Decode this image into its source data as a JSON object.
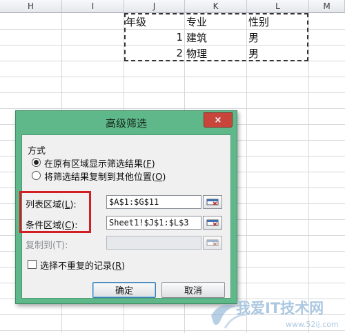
{
  "sheet": {
    "columns": [
      "H",
      "I",
      "J",
      "K",
      "L",
      "M"
    ],
    "criteria_rows": [
      {
        "no": "",
        "major": "专业",
        "gender": "性别",
        "head": "年级"
      },
      {
        "no": "1",
        "major": "建筑",
        "gender": "男",
        "head": ""
      },
      {
        "no": "2",
        "major": "物理",
        "gender": "男",
        "head": ""
      }
    ]
  },
  "dialog": {
    "title": "高级筛选",
    "close_glyph": "×",
    "method_label": "方式",
    "option_inplace": "在原有区域显示筛选结果(",
    "option_inplace_key": "F",
    "option_copy": "将筛选结果复制到其他位置(",
    "option_copy_key": "O",
    "list_range_label": "列表区域(",
    "list_range_key": "L",
    "list_range_value": "$A$1:$G$11",
    "criteria_range_label": "条件区域(",
    "criteria_range_key": "C",
    "criteria_range_value": "Sheet1!$J$1:$L$3",
    "copy_to_label": "复制到(T):",
    "copy_to_value": "",
    "unique_label": "选择不重复的记录(",
    "unique_key": "R",
    "ok_label": "确定",
    "cancel_label": "取消",
    "close_paren": ")",
    "colon_paren": "):"
  },
  "watermark": {
    "brand": "我爱IT技术网",
    "url": "www.52ij.com"
  },
  "colors": {
    "dialog_frame": "#5fb88a",
    "highlight": "#d21f23",
    "close_button": "#c8453c"
  }
}
